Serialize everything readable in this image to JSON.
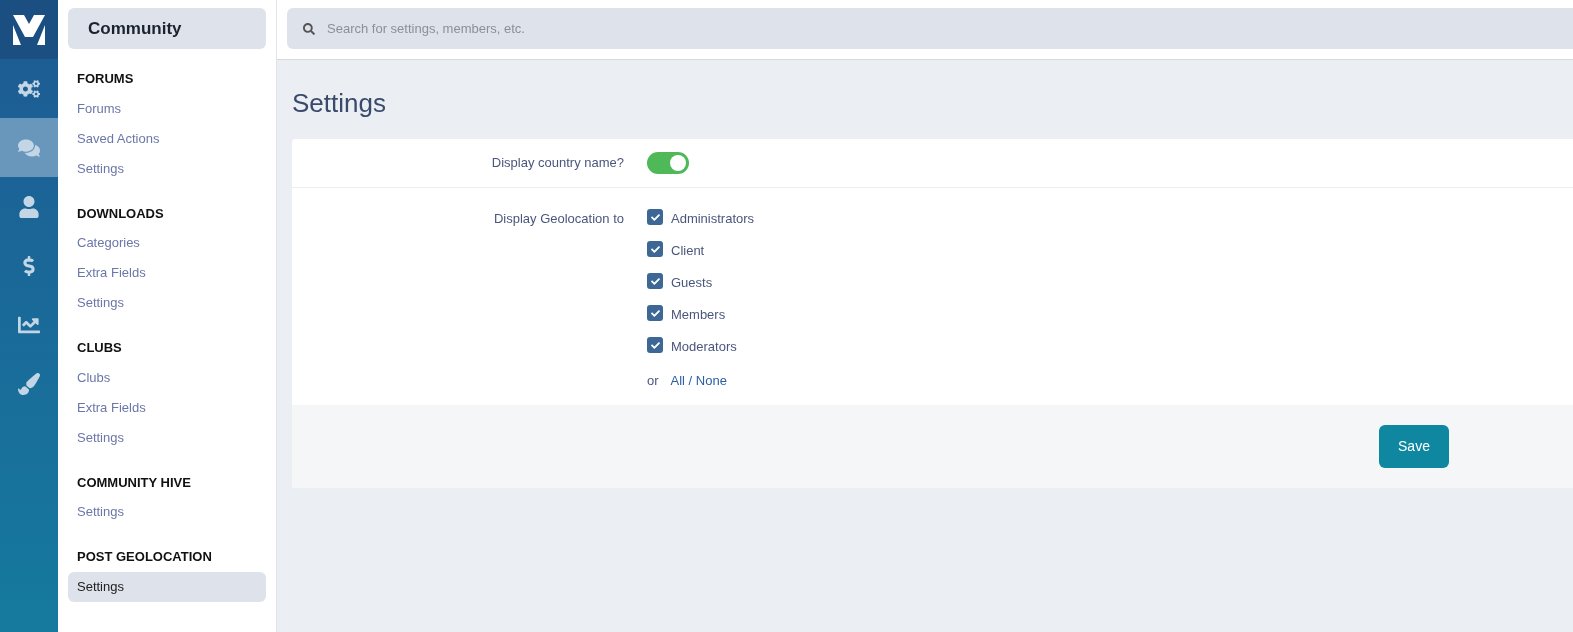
{
  "rail": [
    {
      "kind": "gears",
      "selected": false
    },
    {
      "kind": "comments",
      "selected": true
    },
    {
      "kind": "user",
      "selected": false
    },
    {
      "kind": "dollar",
      "selected": false
    },
    {
      "kind": "chart",
      "selected": false
    },
    {
      "kind": "brush",
      "selected": false
    }
  ],
  "sidebar": {
    "title": "Community",
    "sections": [
      {
        "heading": "FORUMS",
        "items": [
          {
            "label": "Forums",
            "selected": false
          },
          {
            "label": "Saved Actions",
            "selected": false
          },
          {
            "label": "Settings",
            "selected": false
          }
        ]
      },
      {
        "heading": "DOWNLOADS",
        "items": [
          {
            "label": "Categories",
            "selected": false
          },
          {
            "label": "Extra Fields",
            "selected": false
          },
          {
            "label": "Settings",
            "selected": false
          }
        ]
      },
      {
        "heading": "CLUBS",
        "items": [
          {
            "label": "Clubs",
            "selected": false
          },
          {
            "label": "Extra Fields",
            "selected": false
          },
          {
            "label": "Settings",
            "selected": false
          }
        ]
      },
      {
        "heading": "COMMUNITY HIVE",
        "items": [
          {
            "label": "Settings",
            "selected": false
          }
        ]
      },
      {
        "heading": "POST GEOLOCATION",
        "items": [
          {
            "label": "Settings",
            "selected": true
          }
        ]
      }
    ]
  },
  "search": {
    "placeholder": "Search for settings, members, etc."
  },
  "page_title": "Settings",
  "form": {
    "toggle_row": {
      "label": "Display country name?",
      "on": true
    },
    "checkbox_row": {
      "label": "Display Geolocation to",
      "options": [
        {
          "label": "Administrators",
          "checked": true
        },
        {
          "label": "Client",
          "checked": true
        },
        {
          "label": "Guests",
          "checked": true
        },
        {
          "label": "Members",
          "checked": true
        },
        {
          "label": "Moderators",
          "checked": true
        }
      ],
      "or_text": "or",
      "all_none": "All / None"
    },
    "save_button": "Save"
  }
}
